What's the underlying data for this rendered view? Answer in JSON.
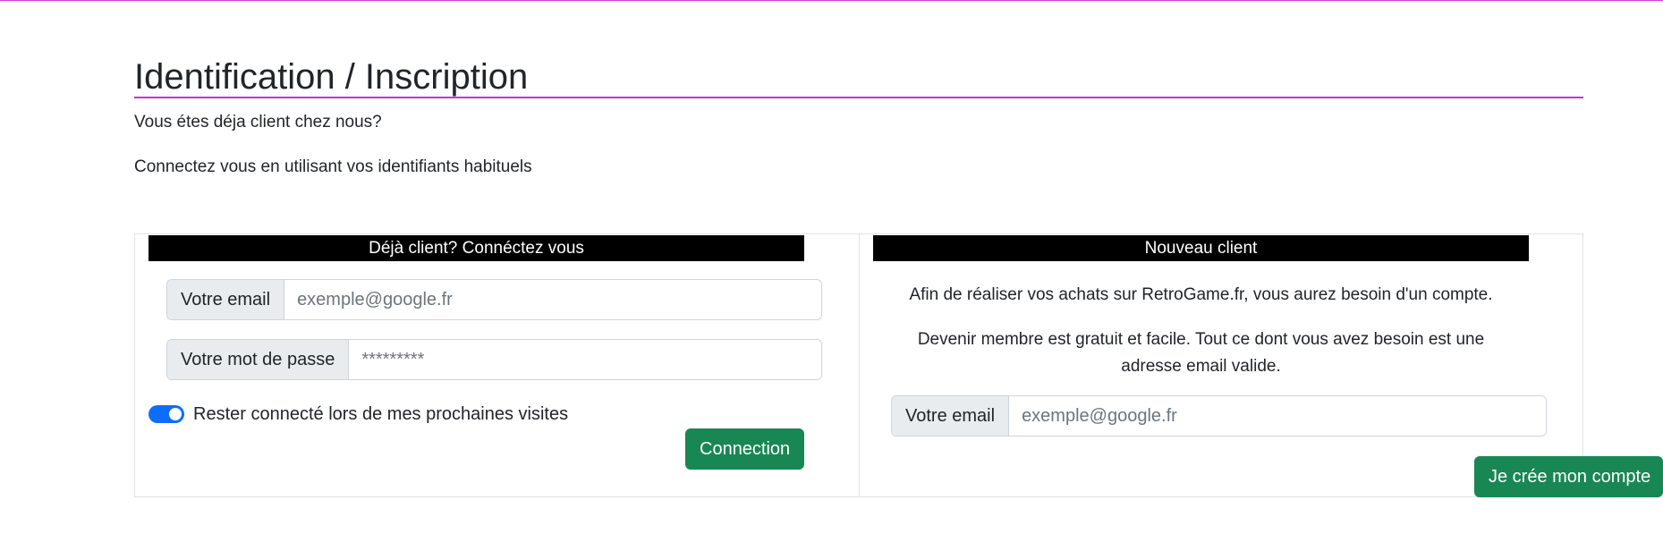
{
  "page": {
    "title": "Identification / Inscription",
    "intro_question": "Vous étes déja client chez nous?",
    "intro_hint": "Connectez vous en utilisant vos identifiants habituels"
  },
  "login_panel": {
    "header": "Déjà client? Connéctez vous",
    "email_label": "Votre email",
    "email_placeholder": "exemple@google.fr",
    "password_label": "Votre mot de passe",
    "password_placeholder": "*********",
    "remember_label": "Rester connecté lors de mes prochaines visites",
    "remember_checked": true,
    "submit_label": "Connection"
  },
  "register_panel": {
    "header": "Nouveau client",
    "text_1": "Afin de réaliser vos achats sur RetroGame.fr, vous aurez besoin d'un compte.",
    "text_2": "Devenir membre est gratuit et facile. Tout ce dont vous avez besoin est une adresse email valide.",
    "email_label": "Votre email",
    "email_placeholder": "exemple@google.fr",
    "submit_label": "Je crée mon compte"
  },
  "colors": {
    "accent_rule": "#cc33cc",
    "header_bg": "#000000",
    "button_success": "#198754",
    "switch_on": "#0d6efd"
  }
}
